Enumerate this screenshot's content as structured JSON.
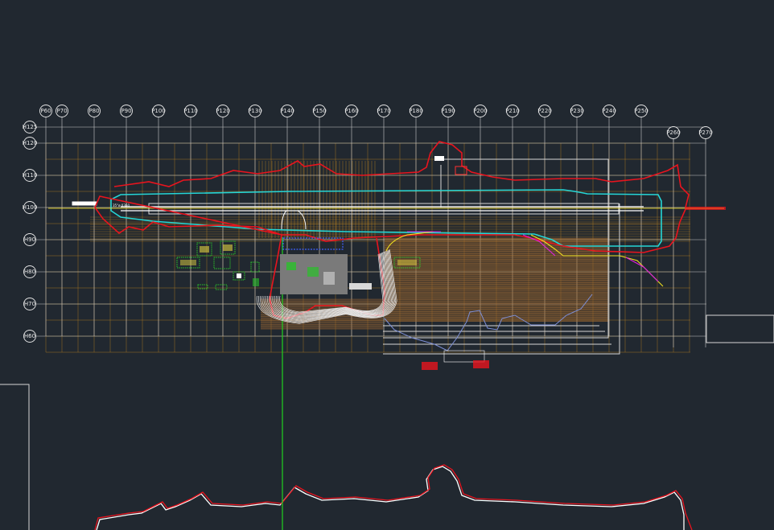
{
  "colors": {
    "background": "#212830",
    "grid_white": "#c9c9c9",
    "grid_orange": "#c8891e",
    "boundary_red": "#e8141e",
    "taxiway_cyan": "#25d6d6",
    "runway_white": "#ffffff",
    "apron_brown": "#8a5a2a",
    "axis_green": "#1fd11f",
    "contour_blue": "#7d8fd6",
    "route_yellow": "#f0e020",
    "route_magenta": "#e020e0"
  },
  "grid": {
    "column_labels": [
      "P60",
      "P70",
      "P80",
      "P90",
      "P100",
      "P110",
      "P120",
      "P130",
      "P140",
      "P150",
      "P160",
      "P170",
      "P180",
      "P190",
      "P200",
      "P210",
      "P220",
      "P230",
      "P240",
      "P250"
    ],
    "extra_column_labels": [
      "P260",
      "P270"
    ],
    "row_labels": [
      "H125",
      "H120",
      "H110",
      "H100",
      "H90",
      "H80",
      "H70",
      "H60"
    ]
  },
  "annotations": {
    "runway_label": "35°ø 0360",
    "left_marker": "",
    "tower_label": "",
    "bottom_label_1": "",
    "bottom_label_2": ""
  }
}
